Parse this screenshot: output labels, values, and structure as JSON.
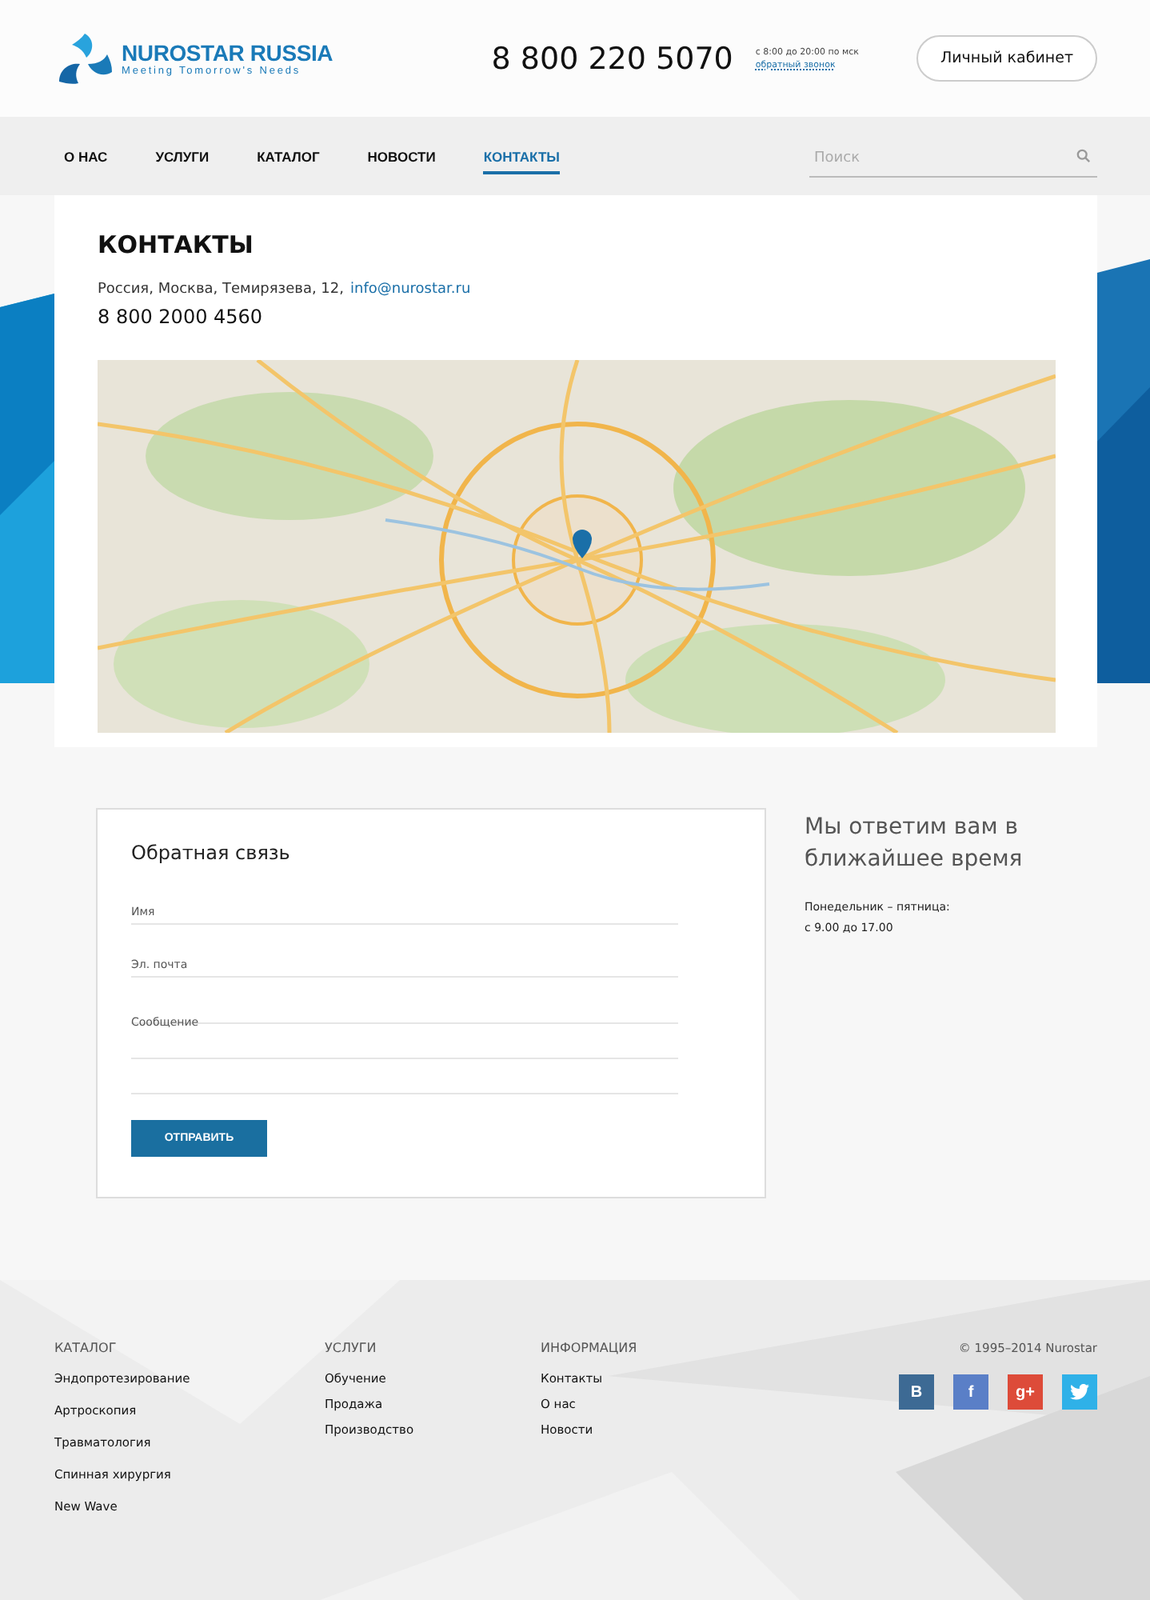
{
  "header": {
    "brand": "NUROSTAR RUSSIA",
    "tagline": "Meeting Tomorrow's Needs",
    "phone": "8 800 220 5070",
    "hours": "с 8:00 до 20:00 по мск",
    "callback": "обратный звонок",
    "account_button": "Личный кабинет"
  },
  "nav": {
    "items": [
      {
        "label": "О НАС",
        "selected": false
      },
      {
        "label": "УСЛУГИ",
        "selected": false
      },
      {
        "label": "КАТАЛОГ",
        "selected": false
      },
      {
        "label": "НОВОСТИ",
        "selected": false
      },
      {
        "label": "КОНТАКТЫ",
        "selected": true
      }
    ],
    "search": {
      "placeholder": "Поиск"
    }
  },
  "contacts": {
    "title": "КОНТАКТЫ",
    "address": "Россия, Москва, Темирязева, 12,",
    "email": "info@nurostar.ru",
    "phone": "8 800 2000 4560"
  },
  "feedback": {
    "title": "Обратная связь",
    "fields": [
      {
        "placeholder": "Имя",
        "kind": "line"
      },
      {
        "placeholder": "Эл. почта",
        "kind": "line"
      },
      {
        "placeholder": "Сообщение",
        "kind": "area"
      }
    ],
    "submit": "ОТПРАВИТЬ"
  },
  "info": {
    "heading": "Мы ответим вам в ближайшее время",
    "days": "Понедельник – пятница:",
    "time": "с 9.00 до 17.00"
  },
  "footer": {
    "columns": [
      {
        "title": "КАТАЛОГ",
        "links": [
          "Эндопротезирование",
          "Артроскопия",
          "Травматология",
          "Спинная хирургия",
          "New Wave"
        ]
      },
      {
        "title": "УСЛУГИ",
        "links": [
          "Обучение",
          "Продажа",
          "Производство"
        ]
      },
      {
        "title": "ИНФОРМАЦИЯ",
        "links": [
          "Контакты",
          "О нас",
          "Новости"
        ]
      }
    ],
    "copyright": "© 1995–2014 Nurostar",
    "social": [
      {
        "kind": "vk",
        "glyph": "В",
        "color": "#3d6a94"
      },
      {
        "kind": "facebook",
        "glyph": "f",
        "color": "#5a7fc7"
      },
      {
        "kind": "google",
        "glyph": "g+",
        "color": "#dd4b39"
      },
      {
        "kind": "twitter",
        "color": "#2fb1e8"
      }
    ]
  }
}
